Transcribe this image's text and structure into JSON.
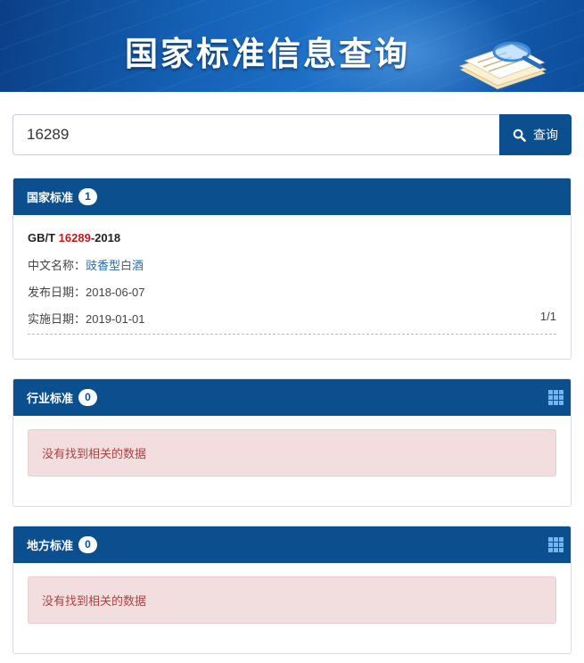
{
  "banner": {
    "title": "国家标准信息查询"
  },
  "search": {
    "value": "16289",
    "button_label": "查询",
    "icon": "search-icon"
  },
  "national": {
    "title": "国家标准",
    "count": "1",
    "record": {
      "code_prefix": "GB/T ",
      "code_highlight": "16289",
      "code_suffix": "-2018",
      "name_label": "中文名称：",
      "name_value": "豉香型白酒",
      "publish_label": "发布日期：",
      "publish_value": "2018-06-07",
      "implement_label": "实施日期：",
      "implement_value": "2019-01-01",
      "pager": "1/1"
    }
  },
  "industry": {
    "title": "行业标准",
    "count": "0",
    "empty_message": "没有找到相关的数据",
    "icon": "grid-icon"
  },
  "local": {
    "title": "地方标准",
    "count": "0",
    "empty_message": "没有找到相关的数据",
    "icon": "grid-icon"
  },
  "colors": {
    "header_blue": "#0b4f8f",
    "highlight_red": "#c8161d",
    "alert_bg": "#f2dede",
    "alert_text": "#a94442"
  }
}
